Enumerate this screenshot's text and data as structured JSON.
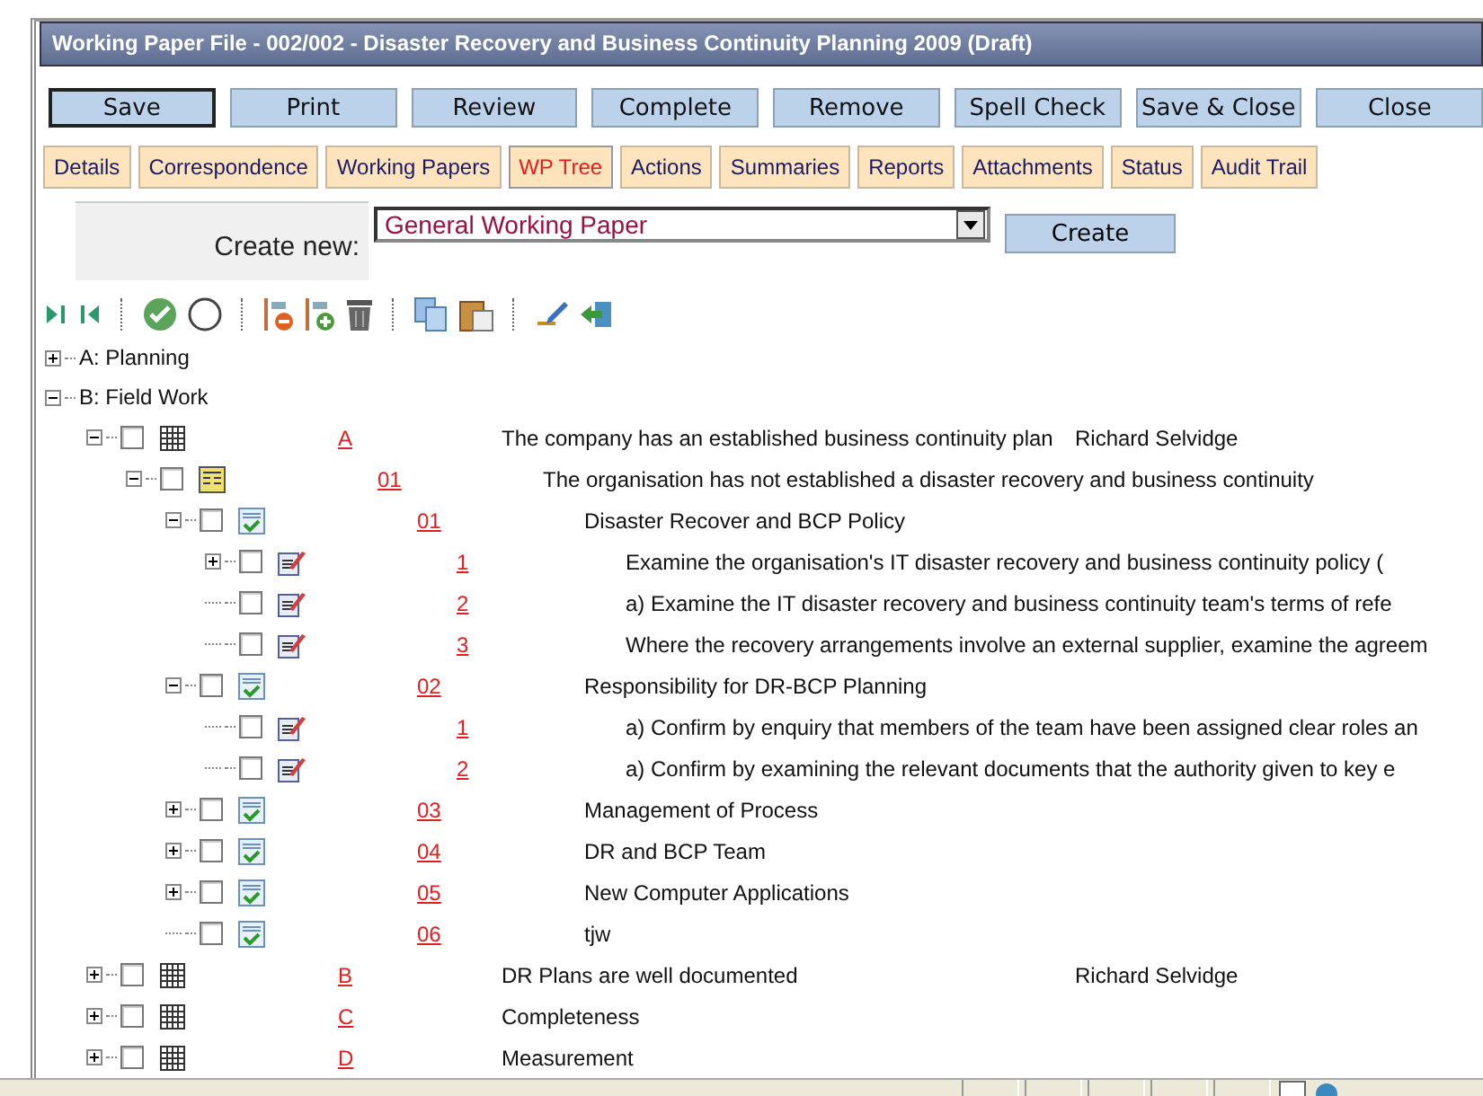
{
  "window": {
    "title": "Working Paper File - 002/002 - Disaster Recovery and Business Continuity Planning 2009 (Draft)"
  },
  "buttons": [
    {
      "label": "Save",
      "focused": true
    },
    {
      "label": "Print",
      "focused": false
    },
    {
      "label": "Review",
      "focused": false
    },
    {
      "label": "Complete",
      "focused": false
    },
    {
      "label": "Remove",
      "focused": false
    },
    {
      "label": "Spell Check",
      "focused": false
    },
    {
      "label": "Save & Close",
      "focused": false
    },
    {
      "label": "Close",
      "focused": false
    }
  ],
  "tabs": [
    {
      "label": "Details",
      "selected": false
    },
    {
      "label": "Correspondence",
      "selected": false
    },
    {
      "label": "Working Papers",
      "selected": false
    },
    {
      "label": "WP Tree",
      "selected": true
    },
    {
      "label": "Actions",
      "selected": false
    },
    {
      "label": "Summaries",
      "selected": false
    },
    {
      "label": "Reports",
      "selected": false
    },
    {
      "label": "Attachments",
      "selected": false
    },
    {
      "label": "Status",
      "selected": false
    },
    {
      "label": "Audit Trail",
      "selected": false
    }
  ],
  "create": {
    "label": "Create new:",
    "value": "General Working Paper",
    "button": "Create"
  },
  "sections": [
    {
      "label": "A: Planning",
      "expanded": false
    },
    {
      "label": "B: Field Work",
      "expanded": true,
      "items": [
        {
          "kind": "grid",
          "code": "A",
          "text": "The company has an established business continuity plan",
          "owner": "Richard Selvidge",
          "checked": false,
          "expanded": true,
          "children": [
            {
              "kind": "form",
              "code": "01",
              "text": "The organisation has not established a disaster recovery and business continuity",
              "checked": false,
              "expanded": true,
              "children": [
                {
                  "kind": "checklist",
                  "code": "01",
                  "text": "Disaster Recover and BCP Policy",
                  "checked": false,
                  "expanded": true,
                  "children": [
                    {
                      "kind": "note",
                      "code": "1",
                      "text": "Examine the organisation's IT disaster recovery and business continuity policy (",
                      "checked": false,
                      "expanded": false
                    },
                    {
                      "kind": "note",
                      "code": "2",
                      "text": "a) Examine the IT disaster recovery and business continuity team's terms of refe",
                      "checked": false
                    },
                    {
                      "kind": "note",
                      "code": "3",
                      "text": "Where the recovery arrangements involve an external supplier, examine the agreem",
                      "checked": false
                    }
                  ]
                },
                {
                  "kind": "checklist",
                  "code": "02",
                  "text": "Responsibility for DR-BCP Planning",
                  "checked": false,
                  "expanded": true,
                  "children": [
                    {
                      "kind": "note",
                      "code": "1",
                      "text": "a) Confirm by enquiry that members of the team have been assigned clear roles an",
                      "checked": false
                    },
                    {
                      "kind": "note",
                      "code": "2",
                      "text": "a) Confirm by examining the relevant documents that the authority given to key e",
                      "checked": false
                    }
                  ]
                },
                {
                  "kind": "checklist",
                  "code": "03",
                  "text": "Management of Process",
                  "checked": false,
                  "expanded": false
                },
                {
                  "kind": "checklist",
                  "code": "04",
                  "text": "DR and BCP Team",
                  "checked": false,
                  "expanded": false
                },
                {
                  "kind": "checklist",
                  "code": "05",
                  "text": "New Computer Applications",
                  "checked": false,
                  "expanded": false
                },
                {
                  "kind": "checklist",
                  "code": "06",
                  "text": "tjw",
                  "checked": false
                }
              ]
            }
          ]
        },
        {
          "kind": "grid",
          "code": "B",
          "text": "DR Plans are well documented",
          "owner": "Richard Selvidge",
          "checked": false,
          "expanded": false
        },
        {
          "kind": "grid",
          "code": "C",
          "text": "Completeness",
          "checked": false,
          "expanded": false
        },
        {
          "kind": "grid",
          "code": "D",
          "text": "Measurement",
          "checked": false,
          "expanded": false
        }
      ]
    }
  ]
}
